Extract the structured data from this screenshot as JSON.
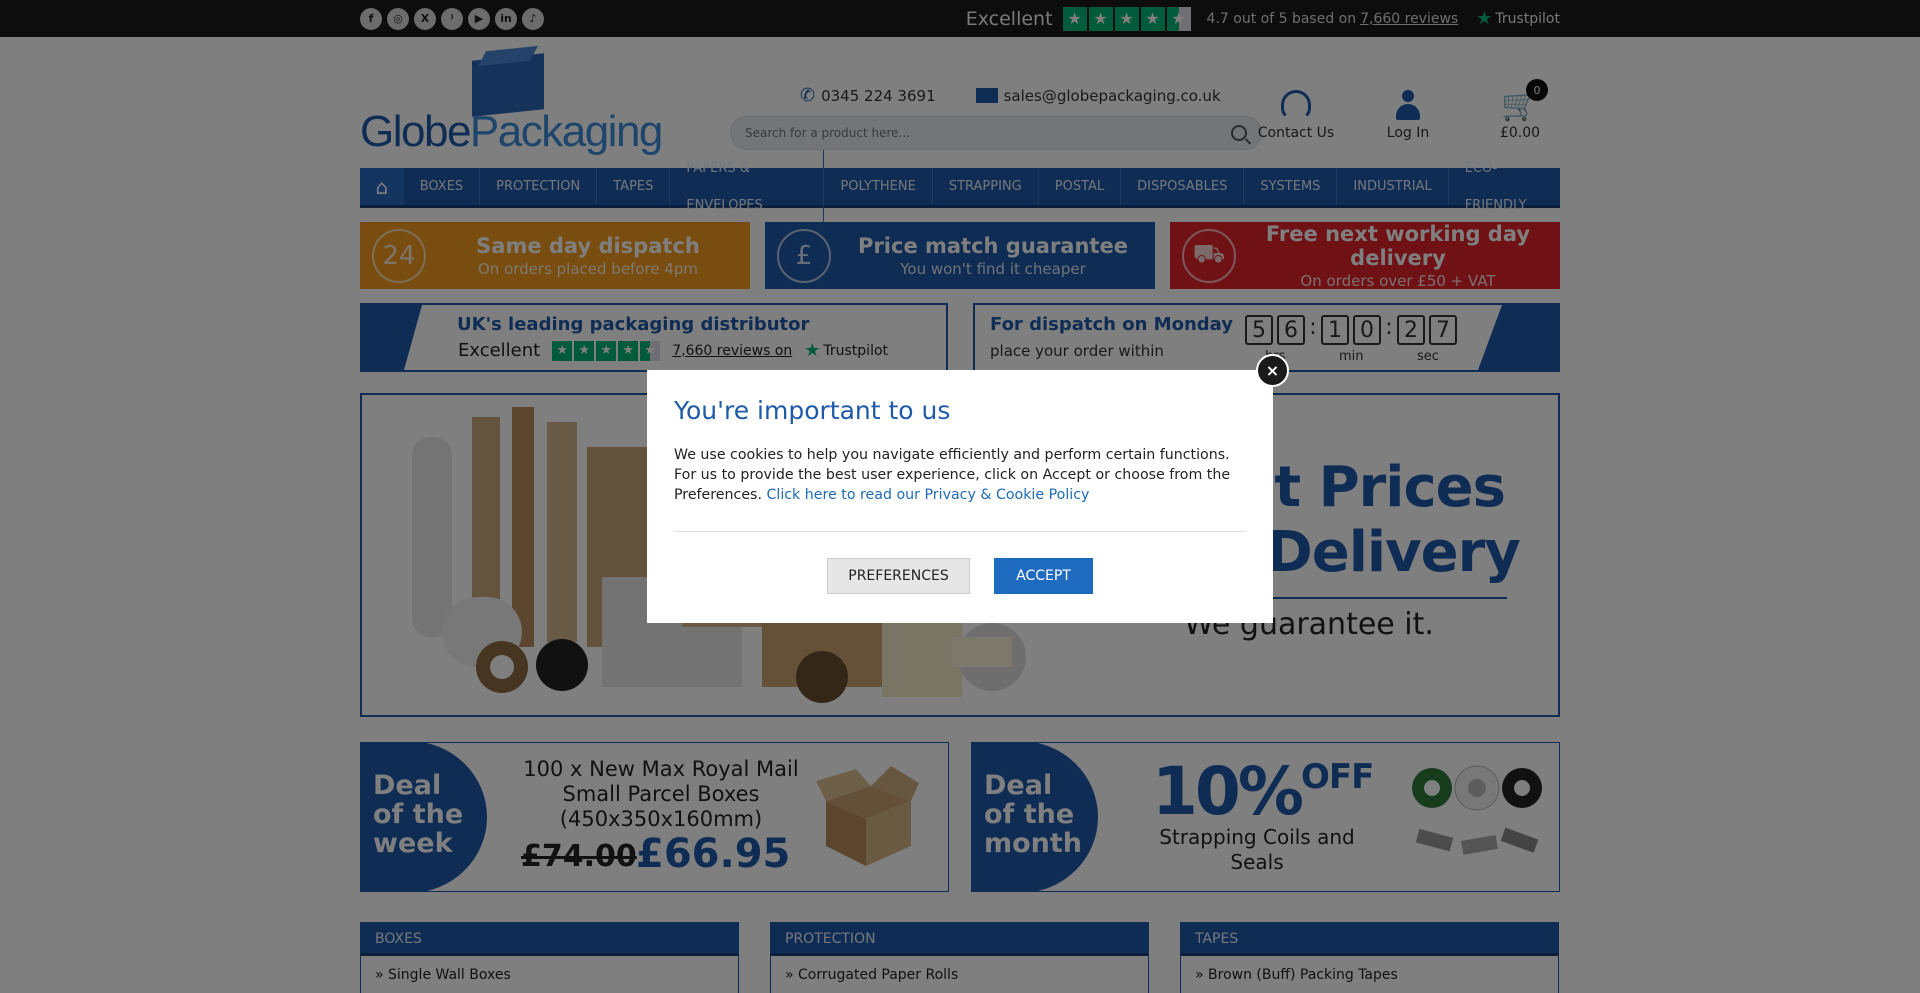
{
  "topbar": {
    "social": [
      {
        "icon": "facebook-icon",
        "glyph": "f"
      },
      {
        "icon": "instagram-icon",
        "glyph": "◎"
      },
      {
        "icon": "x-icon",
        "glyph": "X"
      },
      {
        "icon": "rss-icon",
        "glyph": "⁾"
      },
      {
        "icon": "youtube-icon",
        "glyph": "▶"
      },
      {
        "icon": "linkedin-icon",
        "glyph": "in"
      },
      {
        "icon": "tiktok-icon",
        "glyph": "♪"
      }
    ],
    "rating_word": "Excellent",
    "rating_text": "4.7 out of 5 based on",
    "review_count": "7,660 reviews",
    "trustpilot": "Trustpilot"
  },
  "header": {
    "logo_part1": "Globe",
    "logo_part2": "Packaging",
    "phone": "0345 224 3691",
    "email": "sales@globepackaging.co.uk",
    "search_placeholder": "Search for a product here...",
    "contact_label": "Contact Us",
    "login_label": "Log In",
    "cart_count": "0",
    "cart_total": "£0.00"
  },
  "nav": {
    "items": [
      "Boxes",
      "Protection",
      "Tapes",
      "Papers & Envelopes",
      "Polythene",
      "Strapping",
      "Postal",
      "Disposables",
      "Systems",
      "Industrial",
      "Eco-Friendly"
    ]
  },
  "promos": [
    {
      "title": "Same day dispatch",
      "sub": "On orders placed before 4pm",
      "color": "#f39a1e"
    },
    {
      "title": "Price match guarantee",
      "sub": "You won't find it cheaper",
      "color": "#1f5aa8"
    },
    {
      "title": "Free next working day delivery",
      "sub": "On orders over £50 + VAT",
      "color": "#e1242a"
    }
  ],
  "info": {
    "leading": "UK's leading packaging distributor",
    "excellent": "Excellent",
    "reviews": "7,660 reviews on",
    "trustpilot": "Trustpilot",
    "dispatch_title": "For dispatch on Monday",
    "dispatch_sub": "place your order within",
    "countdown": {
      "h1": "5",
      "h2": "6",
      "m1": "1",
      "m2": "0",
      "s1": "2",
      "s2": "7"
    },
    "labels": {
      "hrs": "hrs",
      "min": "min",
      "sec": "sec"
    }
  },
  "hero": {
    "line1": "st Prices",
    "line2": "t Delivery",
    "guarantee": "We guarantee it."
  },
  "deals": {
    "week": {
      "badge": "Deal of the week",
      "title": "100 x New Max Royal Mail Small Parcel Boxes (450x350x160mm)",
      "old_price": "£74.00",
      "new_price": "£66.95"
    },
    "month": {
      "badge": "Deal of the month",
      "pct": "10%",
      "off": "OFF",
      "sub": "Strapping Coils and Seals"
    }
  },
  "categories": [
    {
      "title": "Boxes",
      "item": "» Single Wall Boxes"
    },
    {
      "title": "Protection",
      "item": "» Corrugated Paper Rolls"
    },
    {
      "title": "Tapes",
      "item": "» Brown (Buff) Packing Tapes"
    }
  ],
  "modal": {
    "title": "You're important to us",
    "body": "We use cookies to help you navigate efficiently and perform certain functions. For us to provide the best user experience, click on Accept or choose from the Preferences.",
    "link": "Click here to read our Privacy & Cookie Policy",
    "preferences": "PREFERENCES",
    "accept": "ACCEPT",
    "close": "×"
  }
}
